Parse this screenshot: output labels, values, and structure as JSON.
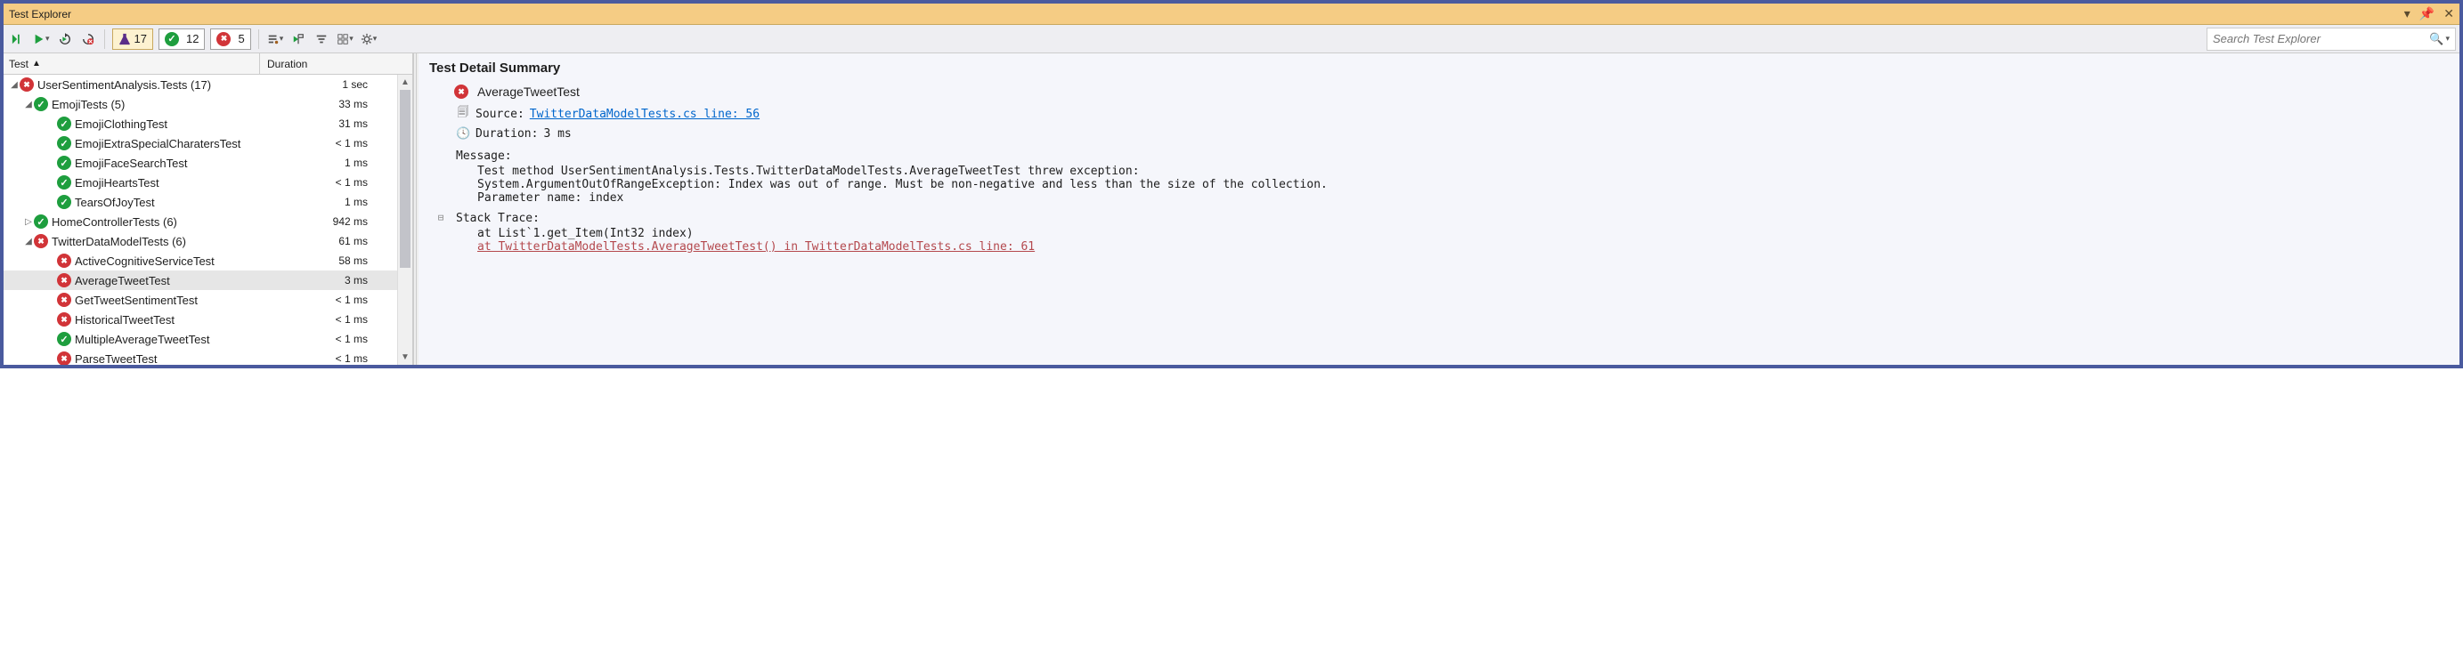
{
  "window": {
    "title": "Test Explorer"
  },
  "toolbar": {
    "summary": {
      "total": "17",
      "passed": "12",
      "failed": "5"
    }
  },
  "search": {
    "placeholder": "Search Test Explorer"
  },
  "columns": {
    "test": "Test",
    "duration": "Duration"
  },
  "tree": [
    {
      "level": 0,
      "expander": "▲",
      "status": "fail",
      "name": "UserSentimentAnalysis.Tests  (17)",
      "dur": "1 sec"
    },
    {
      "level": 1,
      "expander": "▲",
      "status": "pass",
      "name": "EmojiTests  (5)",
      "dur": "33 ms"
    },
    {
      "level": 2,
      "leaf": true,
      "status": "pass",
      "name": "EmojiClothingTest",
      "dur": "31 ms"
    },
    {
      "level": 2,
      "leaf": true,
      "status": "pass",
      "name": "EmojiExtraSpecialCharatersTest",
      "dur": "< 1 ms"
    },
    {
      "level": 2,
      "leaf": true,
      "status": "pass",
      "name": "EmojiFaceSearchTest",
      "dur": "1 ms"
    },
    {
      "level": 2,
      "leaf": true,
      "status": "pass",
      "name": "EmojiHeartsTest",
      "dur": "< 1 ms"
    },
    {
      "level": 2,
      "leaf": true,
      "status": "pass",
      "name": "TearsOfJoyTest",
      "dur": "1 ms"
    },
    {
      "level": 1,
      "expander": "▷",
      "status": "pass",
      "name": "HomeControllerTests  (6)",
      "dur": "942 ms"
    },
    {
      "level": 1,
      "expander": "▲",
      "status": "fail",
      "name": "TwitterDataModelTests  (6)",
      "dur": "61 ms"
    },
    {
      "level": 2,
      "leaf": true,
      "status": "fail",
      "name": "ActiveCognitiveServiceTest",
      "dur": "58 ms"
    },
    {
      "level": 2,
      "leaf": true,
      "status": "fail",
      "name": "AverageTweetTest",
      "dur": "3 ms",
      "selected": true
    },
    {
      "level": 2,
      "leaf": true,
      "status": "fail",
      "name": "GetTweetSentimentTest",
      "dur": "< 1 ms"
    },
    {
      "level": 2,
      "leaf": true,
      "status": "fail",
      "name": "HistoricalTweetTest",
      "dur": "< 1 ms"
    },
    {
      "level": 2,
      "leaf": true,
      "status": "pass",
      "name": "MultipleAverageTweetTest",
      "dur": "< 1 ms"
    },
    {
      "level": 2,
      "leaf": true,
      "status": "fail",
      "name": "ParseTweetTest",
      "dur": "< 1 ms"
    }
  ],
  "detail": {
    "heading": "Test Detail Summary",
    "test_name": "AverageTweetTest",
    "source_label": "Source:",
    "source_link": "TwitterDataModelTests.cs line: 56",
    "duration_label": "Duration:",
    "duration_value": "3 ms",
    "message_label": "Message:",
    "message_body": "Test method UserSentimentAnalysis.Tests.TwitterDataModelTests.AverageTweetTest threw exception:\nSystem.ArgumentOutOfRangeException: Index was out of range. Must be non-negative and less than the size of the collection.\nParameter name: index",
    "stack_label": "Stack Trace:",
    "stack_line1": "at List`1.get_Item(Int32 index)",
    "stack_link": "at TwitterDataModelTests.AverageTweetTest() in TwitterDataModelTests.cs line: 61"
  }
}
